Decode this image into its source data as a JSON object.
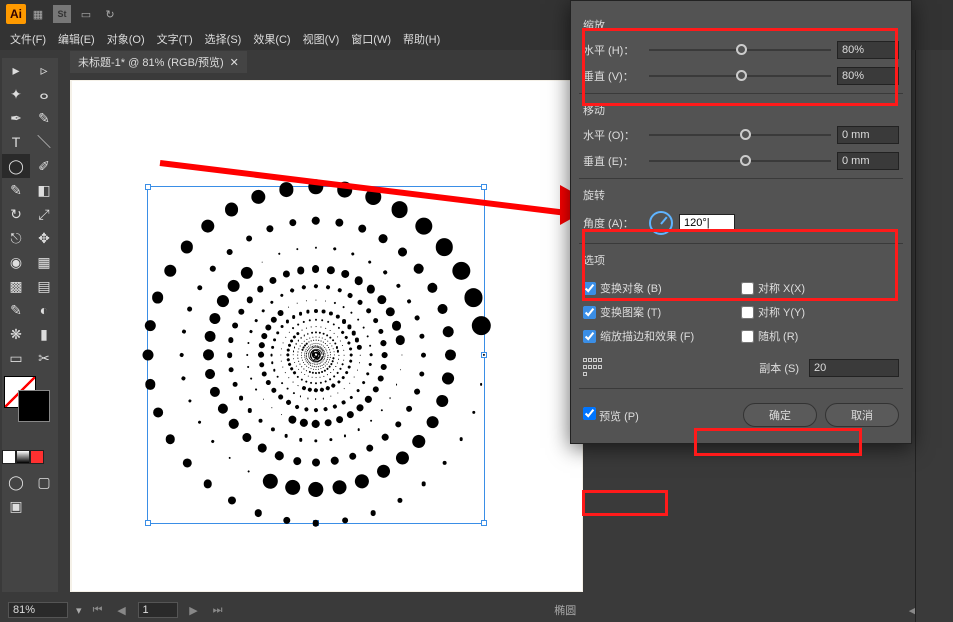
{
  "menubar": [
    "文件(F)",
    "编辑(E)",
    "对象(O)",
    "文字(T)",
    "选择(S)",
    "效果(C)",
    "视图(V)",
    "窗口(W)",
    "帮助(H)"
  ],
  "tab": {
    "title": "未标题-1* @ 81% (RGB/预览)"
  },
  "status": {
    "zoom": "81%",
    "tool": "椭圆"
  },
  "dialog": {
    "scale": {
      "title": "缩放",
      "h_label": "水平 (H)：",
      "h_val": "80%",
      "v_label": "垂直 (V)：",
      "v_val": "80%"
    },
    "move": {
      "title": "移动",
      "h_label": "水平 (O)：",
      "h_val": "0 mm",
      "v_label": "垂直 (E)：",
      "v_val": "0 mm"
    },
    "rotate": {
      "title": "旋转",
      "a_label": "角度 (A)：",
      "a_val": "120°|"
    },
    "opts": {
      "title": "选项",
      "c1": "变换对象 (B)",
      "c2": "对称 X(X)",
      "c3": "变换图案 (T)",
      "c4": "对称 Y(Y)",
      "c5": "缩放描边和效果 (F)",
      "c6": "随机 (R)"
    },
    "copies": {
      "label": "副本 (S)",
      "val": "20"
    },
    "preview": "预览 (P)",
    "ok": "确定",
    "cancel": "取消"
  }
}
